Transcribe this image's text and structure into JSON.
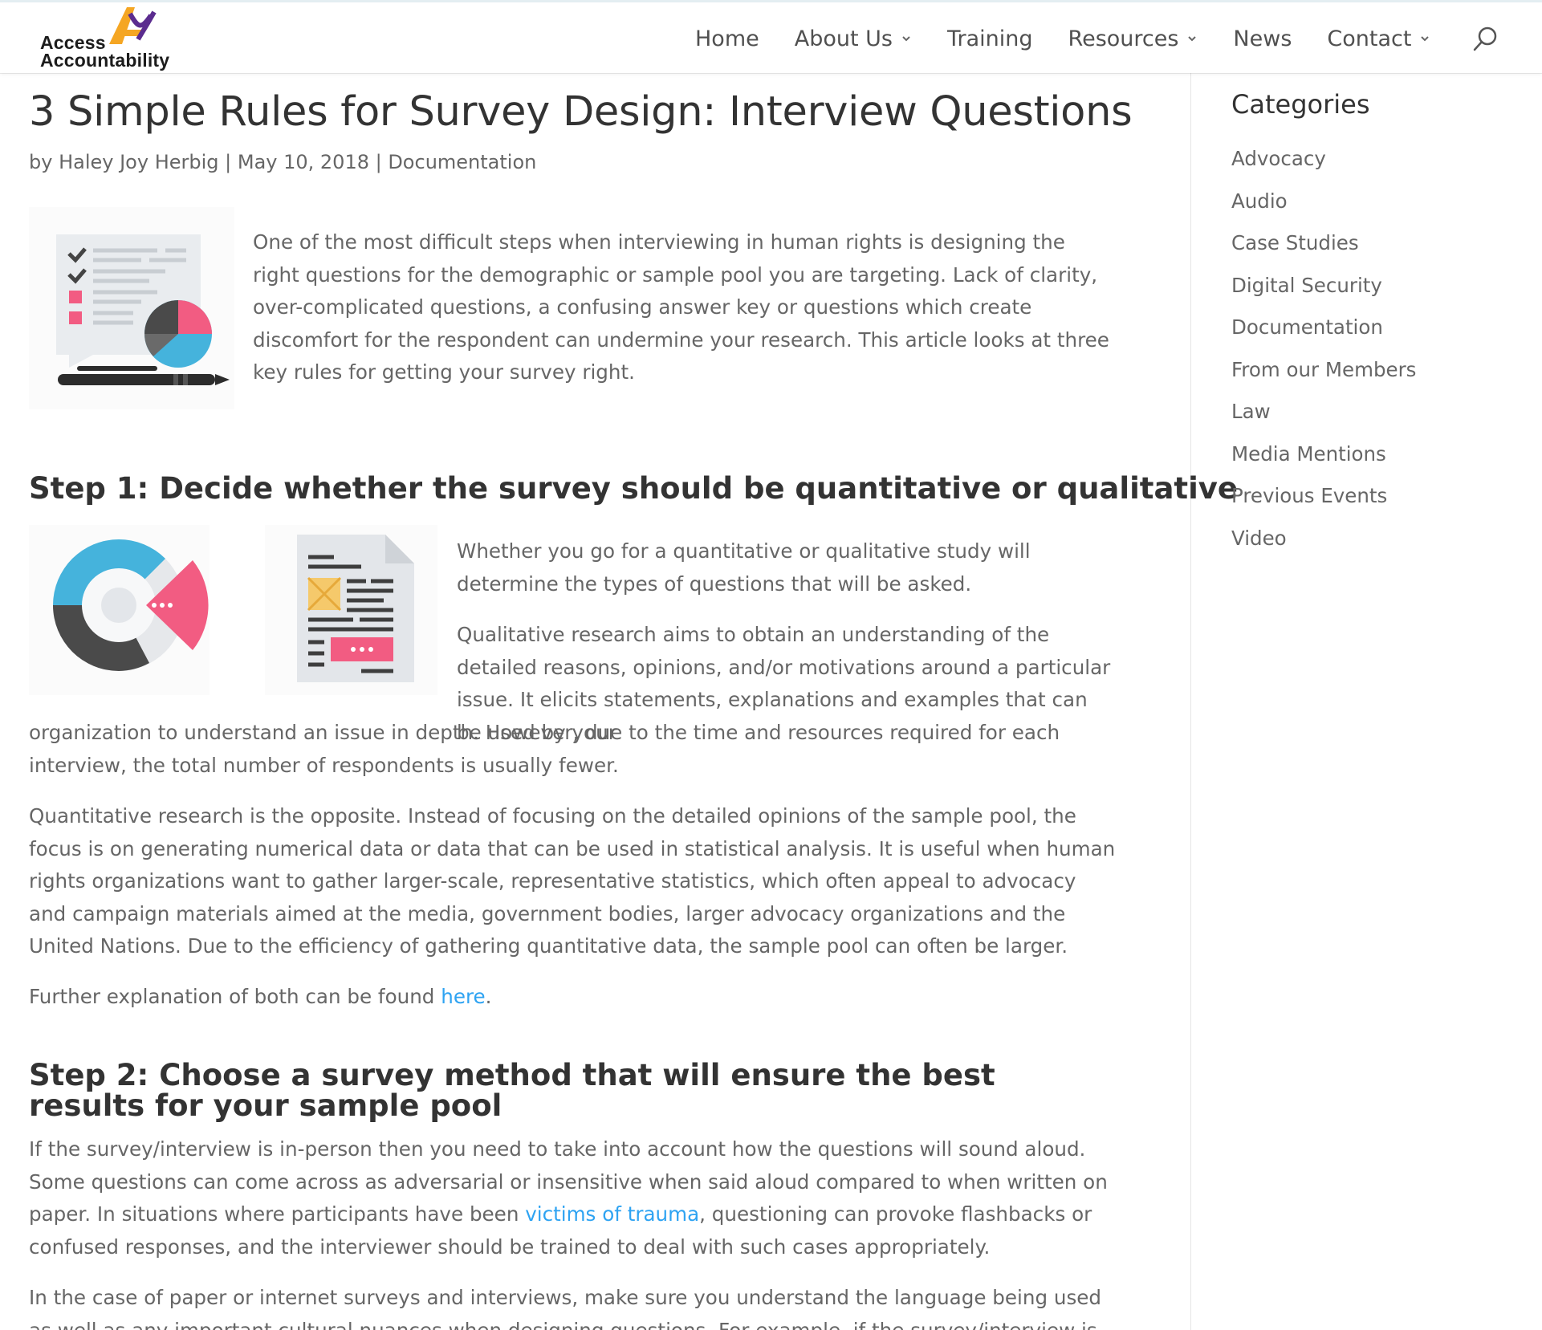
{
  "brand": {
    "line1": "Access",
    "line2": "Accountability",
    "colors": {
      "orange": "#f5a623",
      "purple": "#5b2c8f",
      "dark": "#1c1c1c"
    }
  },
  "nav": {
    "items": [
      {
        "label": "Home",
        "dropdown": false
      },
      {
        "label": "About Us",
        "dropdown": true
      },
      {
        "label": "Training",
        "dropdown": false
      },
      {
        "label": "Resources",
        "dropdown": true
      },
      {
        "label": "News",
        "dropdown": false
      },
      {
        "label": "Contact",
        "dropdown": true
      }
    ],
    "search_icon": "search-icon"
  },
  "post": {
    "title": "3 Simple Rules for Survey Design: Interview Questions",
    "meta": {
      "by": "by",
      "author": "Haley Joy Herbig",
      "sep1": " | ",
      "date": "May 10, 2018",
      "sep2": " | ",
      "category": "Documentation"
    },
    "intro": "One of the most difficult steps when interviewing in human rights is designing the right questions for the demographic or sample pool you are targeting. Lack of clarity, over-complicated questions, a confusing answer key or questions which create discomfort for the respondent can undermine your research. This article looks at three key rules for getting your survey right.",
    "step1": {
      "heading": "Step 1: Decide whether the survey should be quantitative or qualitative",
      "p1": "Whether you go for a quantitative or qualitative study will determine the types of questions that will be asked.",
      "p2_wrapped": "Qualitative research aims to obtain an understanding of the detailed reasons, opinions, and/or motivations around a particular issue. It elicits statements, explanations and examples that can be used by your",
      "p2_rest": "organization to understand an issue in depth. However, due to the time and resources required for each interview, the total number of respondents is usually fewer.",
      "p3": "Quantitative research is the opposite. Instead of focusing on the detailed opinions of the sample pool, the focus is on generating numerical data or data that can be used in statistical analysis. It is useful when human rights organizations want to gather larger-scale, representative statistics, which often appeal to advocacy and campaign materials aimed at the media, government bodies, larger advocacy organizations and the United Nations. Due to the efficiency of gathering quantitative data, the sample pool can often be larger.",
      "p4_before": "Further explanation of both can be found ",
      "p4_link": "here",
      "p4_after": "."
    },
    "step2": {
      "heading": "Step 2: Choose a survey method that will ensure the best results for your sample pool",
      "p1_before": "If the survey/interview is in-person then you need to take into account how the questions will sound aloud. Some questions can come across as adversarial or insensitive when said aloud compared to when written on paper. In situations where participants have been ",
      "p1_link": "victims of trauma",
      "p1_after": ", questioning can provoke flashbacks or confused responses, and the interviewer should be trained to deal with such cases appropriately.",
      "p2": "In the case of paper or internet surveys and interviews, make sure you understand the language being used as well as any important cultural nuances when designing questions. For example, if the survey/interview is written in Korean then it is"
    }
  },
  "sidebar": {
    "title": "Categories",
    "items": [
      "Advocacy",
      "Audio",
      "Case Studies",
      "Digital Security",
      "Documentation",
      "From our Members",
      "Law",
      "Media Mentions",
      "Previous Events",
      "Video"
    ]
  },
  "colors": {
    "link": "#2ea3f2",
    "pink": "#f25c82",
    "blue": "#45b3dc",
    "dark_gray": "#4a4a4a",
    "light_gray": "#e3e6ea"
  }
}
